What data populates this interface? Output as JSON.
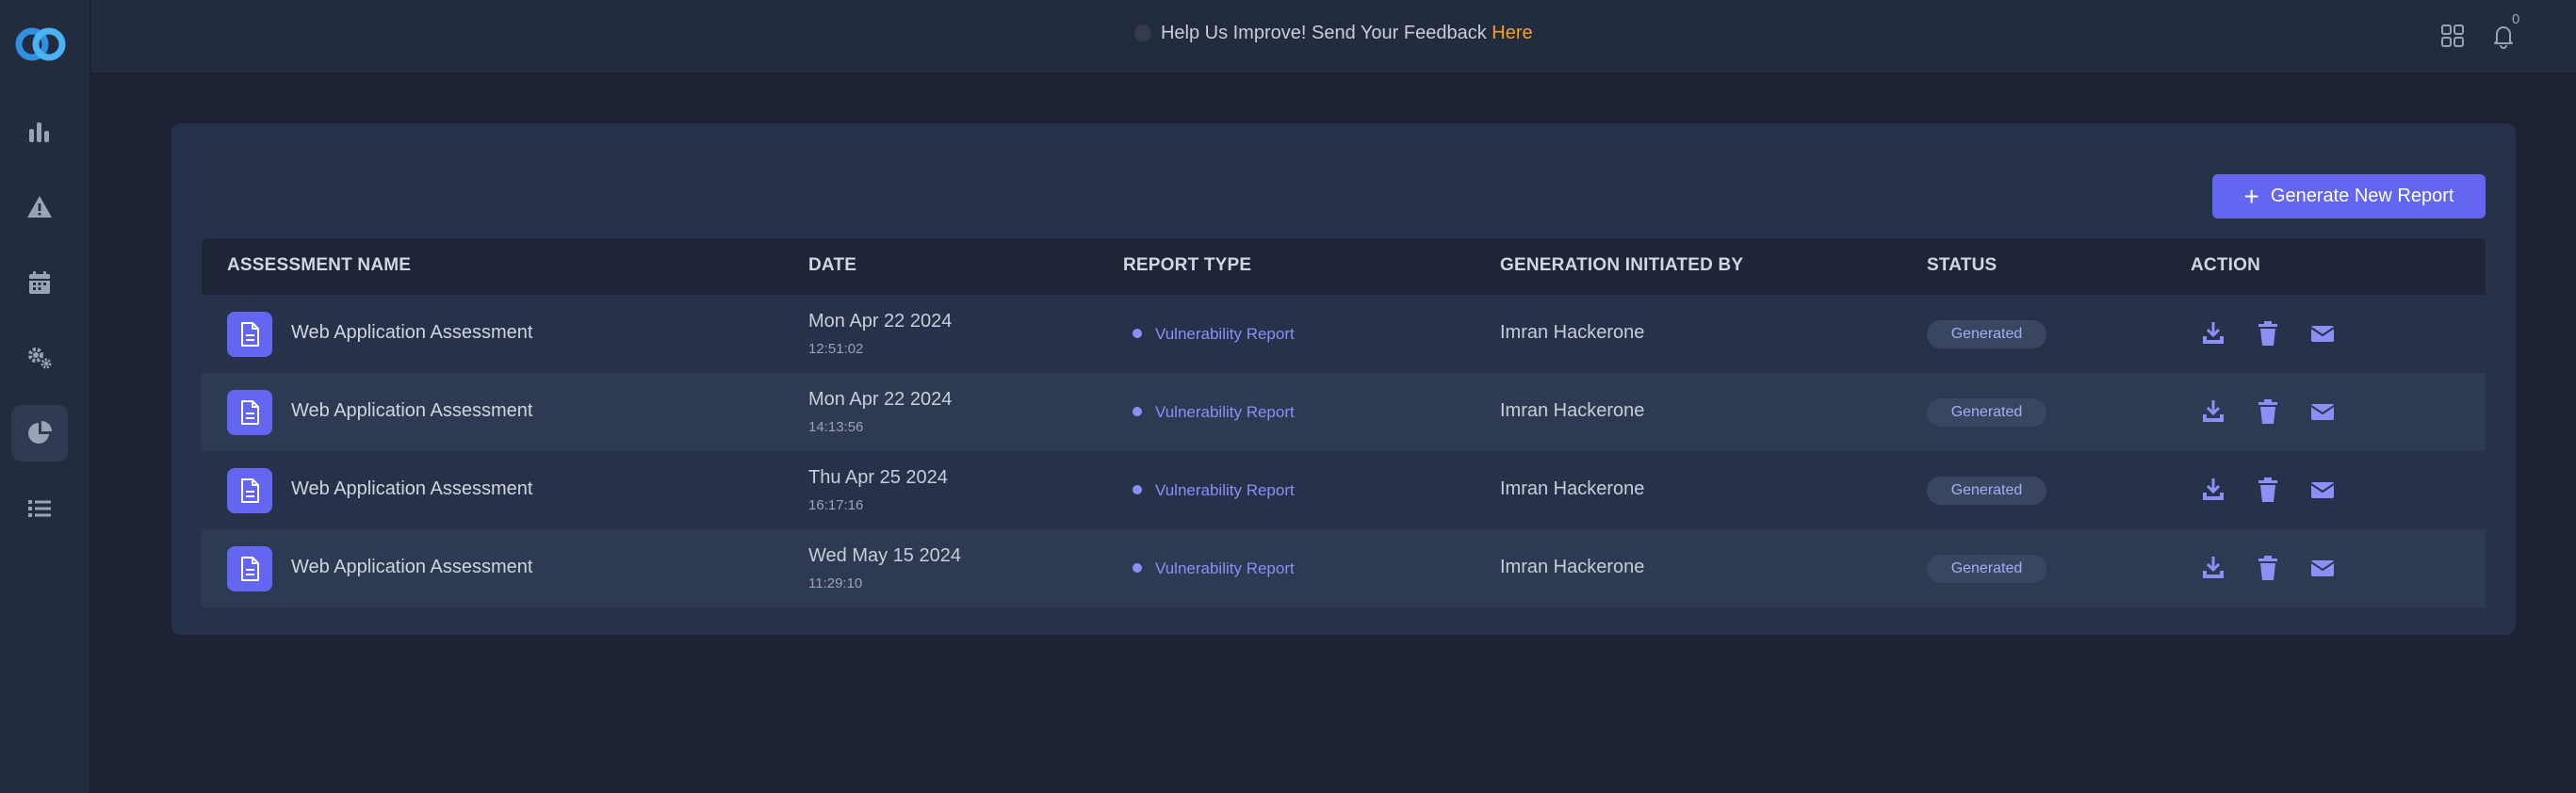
{
  "topbar": {
    "feedback_text": "Help Us Improve! Send Your Feedback ",
    "feedback_link": "Here",
    "notification_count": "0"
  },
  "sidebar": {
    "items": [
      {
        "icon": "bar-chart-icon",
        "active": false
      },
      {
        "icon": "warning-icon",
        "active": false
      },
      {
        "icon": "calendar-icon",
        "active": false
      },
      {
        "icon": "gears-icon",
        "active": false
      },
      {
        "icon": "pie-chart-icon",
        "active": true
      },
      {
        "icon": "list-icon",
        "active": false
      }
    ]
  },
  "main": {
    "generate_button": "Generate New Report",
    "columns": {
      "name": "ASSESSMENT NAME",
      "date": "DATE",
      "type": "REPORT TYPE",
      "by": "GENERATION INITIATED BY",
      "status": "STATUS",
      "action": "ACTION"
    },
    "rows": [
      {
        "name": "Web Application Assessment",
        "date": "Mon Apr 22 2024",
        "time": "12:51:02",
        "type": "Vulnerability Report",
        "by": "Imran Hackerone",
        "status": "Generated"
      },
      {
        "name": "Web Application Assessment",
        "date": "Mon Apr 22 2024",
        "time": "14:13:56",
        "type": "Vulnerability Report",
        "by": "Imran Hackerone",
        "status": "Generated"
      },
      {
        "name": "Web Application Assessment",
        "date": "Thu Apr 25 2024",
        "time": "16:17:16",
        "type": "Vulnerability Report",
        "by": "Imran Hackerone",
        "status": "Generated"
      },
      {
        "name": "Web Application Assessment",
        "date": "Wed May 15 2024",
        "time": "11:29:10",
        "type": "Vulnerability Report",
        "by": "Imran Hackerone",
        "status": "Generated"
      }
    ]
  },
  "colors": {
    "accent": "#6366f1",
    "link": "#f6a11d",
    "background": "#1d2334",
    "card": "#27324a"
  }
}
